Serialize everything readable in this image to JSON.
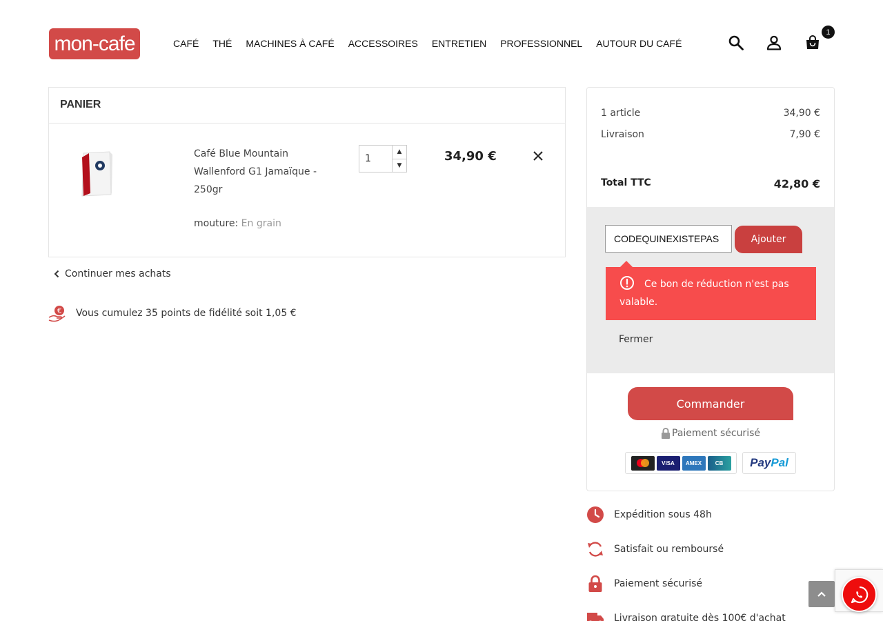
{
  "brand": {
    "logo_text": "mon-cafe",
    "accent": "#d24a48",
    "error": "#f74c4c"
  },
  "nav": {
    "items": [
      "CAFÉ",
      "THÉ",
      "MACHINES À CAFÉ",
      "ACCESSOIRES",
      "ENTRETIEN",
      "PROFESSIONNEL",
      "AUTOUR DU CAFÉ"
    ]
  },
  "header": {
    "icons": [
      "search-icon",
      "user-icon",
      "shopping-bag-icon"
    ],
    "cart_count": "1"
  },
  "cart": {
    "title": "PANIER",
    "item": {
      "name": "Café Blue Mountain Wallenford G1 Jamaïque - 250gr",
      "attr_label": "mouture:",
      "attr_value": "En grain",
      "quantity": "1",
      "price": "34,90 €"
    },
    "continue_label": "Continuer mes achats",
    "loyalty_text": "Vous cumulez 35 points de fidélité soit 1,05 €"
  },
  "summary": {
    "articles_label": "1 article",
    "articles_value": "34,90 €",
    "shipping_label": "Livraison",
    "shipping_value": "7,90 €",
    "total_label": "Total TTC",
    "total_value": "42,80 €",
    "promo_value": "CODEQUINEXISTEPAS",
    "promo_button": "Ajouter",
    "error_message": "Ce bon de réduction n'est pas valable.",
    "close_label": "Fermer",
    "order_button": "Commander",
    "secure_label": "Paiement sécurisé",
    "payment_methods": [
      "Mastercard",
      "VISA",
      "AMEX",
      "CB",
      "PayPal"
    ]
  },
  "reassurance": [
    {
      "icon": "clock-icon",
      "label": "Expédition sous 48h"
    },
    {
      "icon": "refresh-icon",
      "label": "Satisfait ou remboursé"
    },
    {
      "icon": "lock-icon",
      "label": "Paiement sécurisé"
    },
    {
      "icon": "truck-icon",
      "label": "Livraison gratuite dès 100€ d'achat"
    }
  ]
}
